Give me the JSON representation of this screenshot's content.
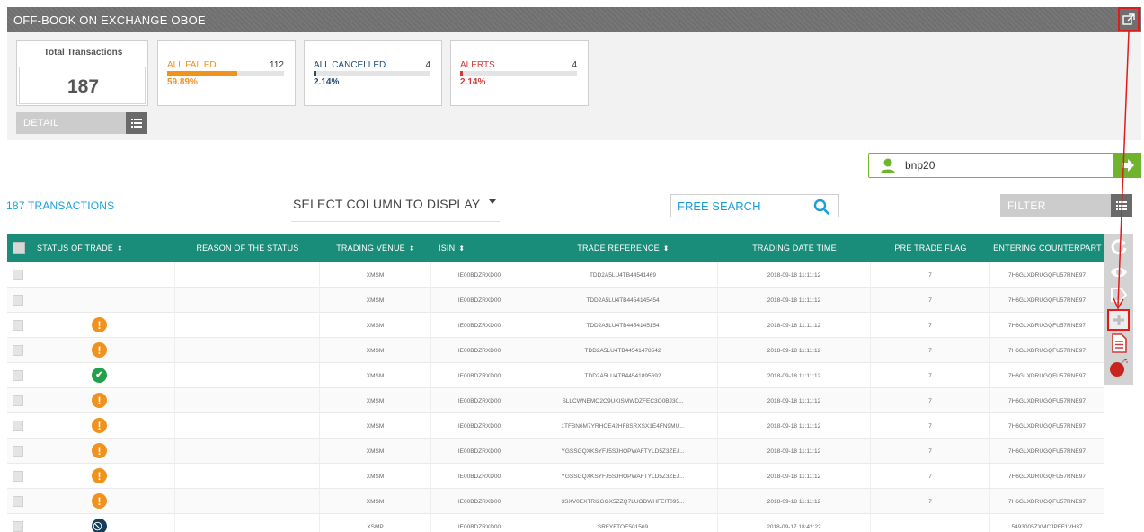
{
  "header": {
    "title": "OFF-BOOK ON EXCHANGE OBOE",
    "export_icon": "external-link-icon"
  },
  "summary": {
    "total_label": "Total Transactions",
    "total_value": "187",
    "cards": [
      {
        "label": "ALL FAILED",
        "count": "112",
        "percent": "59.89%",
        "fill": 0.5989,
        "color": "#f0921e"
      },
      {
        "label": "ALL CANCELLED",
        "count": "4",
        "percent": "2.14%",
        "fill": 0.0214,
        "color": "#1f4e79"
      },
      {
        "label": "ALERTS",
        "count": "4",
        "percent": "2.14%",
        "fill": 0.0214,
        "color": "#d13a3a"
      }
    ],
    "detail_label": "DETAIL"
  },
  "user": {
    "value": "bnp20",
    "accent": "#6eb42c"
  },
  "toolbar": {
    "transactions_label": "187 TRANSACTIONS",
    "column_select_label": "SELECT COLUMN TO DISPLAY",
    "search_placeholder": "FREE SEARCH",
    "filter_label": "FILTER"
  },
  "table": {
    "header_color": "#1a8d7a",
    "columns": [
      {
        "label": "STATUS OF TRADE",
        "sortable": true
      },
      {
        "label": "REASON OF THE STATUS",
        "sortable": false
      },
      {
        "label": "TRADING VENUE",
        "sortable": true
      },
      {
        "label": "ISIN",
        "sortable": true
      },
      {
        "label": "TRADE REFERENCE",
        "sortable": true
      },
      {
        "label": "TRADING DATE TIME",
        "sortable": false
      },
      {
        "label": "PRE TRADE FLAG",
        "sortable": false
      },
      {
        "label": "ENTERING COUNTERPART",
        "sortable": false
      }
    ],
    "rows": [
      {
        "status": "",
        "reason": "",
        "venue": "XMSM",
        "isin": "IE00BDZRXD00",
        "ref": "TDD2A5LU4TB44541469",
        "datetime": "2018-09-18 11:11:12",
        "flag": "7",
        "counterpart": "7H6GLXDRUGQFU57RNE97"
      },
      {
        "status": "",
        "reason": "",
        "venue": "XMSM",
        "isin": "IE00BDZRXD00",
        "ref": "TDD2A5LU4TB4454145454",
        "datetime": "2018-09-18 11:11:12",
        "flag": "7",
        "counterpart": "7H6GLXDRUGQFU57RNE97"
      },
      {
        "status": "warning",
        "reason": "",
        "venue": "XMSM",
        "isin": "IE00BDZRXD00",
        "ref": "TDD2A5LU4TB4454145154",
        "datetime": "2018-09-18 11:11:12",
        "flag": "7",
        "counterpart": "7H6GLXDRUGQFU57RNE97"
      },
      {
        "status": "warning",
        "reason": "",
        "venue": "XMSM",
        "isin": "IE00BDZRXD00",
        "ref": "TDD2A5LU4TB44541478542",
        "datetime": "2018-09-18 11:11:12",
        "flag": "7",
        "counterpart": "7H6GLXDRUGQFU57RNE97"
      },
      {
        "status": "ok",
        "reason": "",
        "venue": "XMSM",
        "isin": "IE00BDZRXD00",
        "ref": "TDD2A5LU4TB44541895692",
        "datetime": "2018-09-18 11:11:12",
        "flag": "7",
        "counterpart": "7H6GLXDRUGQFU57RNE97"
      },
      {
        "status": "warning",
        "reason": "",
        "venue": "XMSM",
        "isin": "IE00BDZRXD00",
        "ref": "SLLCWNEMO2O9UKISMWDZFEC3O0BJ30...",
        "datetime": "2018-09-18 11:11:12",
        "flag": "7",
        "counterpart": "7H6GLXDRUGQFU57RNE97"
      },
      {
        "status": "warning",
        "reason": "",
        "venue": "XMSM",
        "isin": "IE00BDZRXD00",
        "ref": "1TFBN6M7YRHOE42HF8SRXSX1E4FN9MU...",
        "datetime": "2018-09-18 11:11:12",
        "flag": "7",
        "counterpart": "7H6GLXDRUGQFU57RNE97"
      },
      {
        "status": "warning",
        "reason": "",
        "venue": "XMSM",
        "isin": "IE00BDZRXD00",
        "ref": "YGSSGQXKSYFJ5SJHOPWAFTYLD5Z3ZEJ...",
        "datetime": "2018-09-18 11:11:12",
        "flag": "7",
        "counterpart": "7H6GLXDRUGQFU57RNE97"
      },
      {
        "status": "warning",
        "reason": "",
        "venue": "XMSM",
        "isin": "IE00BDZRXD00",
        "ref": "YGSSGQXKSYFJ5SJHOPWAFTYLD5Z3ZEJ...",
        "datetime": "2018-09-18 11:11:12",
        "flag": "7",
        "counterpart": "7H6GLXDRUGQFU57RNE97"
      },
      {
        "status": "warning",
        "reason": "",
        "venue": "XMSM",
        "isin": "IE00BDZRXD00",
        "ref": "3SXV0EXTRI2GGX5ZZQ7LUODWHFEIT095...",
        "datetime": "2018-09-18 11:11:12",
        "flag": "7",
        "counterpart": "7H6GLXDRUGQFU57RNE97"
      },
      {
        "status": "blocked",
        "reason": "",
        "venue": "XSMP",
        "isin": "IE00BDZRXD00",
        "ref": "SRFYFTOE501569",
        "datetime": "2018-09-17 18:42:22",
        "flag": "",
        "counterpart": "5493005ZXMCJPFF1VH37"
      }
    ]
  },
  "actions": [
    "refresh-icon",
    "view-icon",
    "tag-icon",
    "add-icon",
    "document-icon",
    "bomb-icon"
  ]
}
